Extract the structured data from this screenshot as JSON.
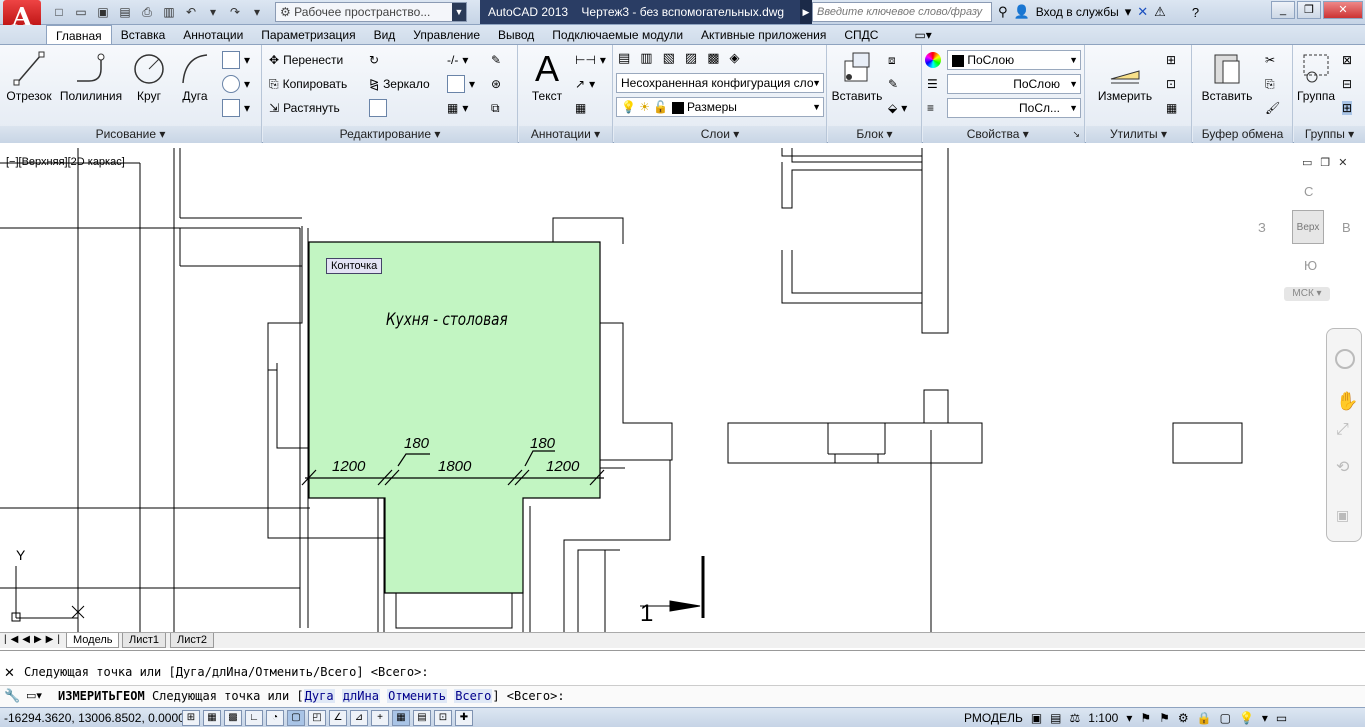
{
  "title_bar": {
    "app_letter": "A",
    "workspace": "Рабочее пространство...",
    "app_name": "AutoCAD 2013",
    "document": "Чертеж3 - без вспомогательных.dwg",
    "search_placeholder": "Введите ключевое слово/фразу",
    "login": "Вход в службы"
  },
  "ribbon_tabs": [
    "Главная",
    "Вставка",
    "Аннотации",
    "Параметризация",
    "Вид",
    "Управление",
    "Вывод",
    "Подключаемые модули",
    "Активные приложения",
    "СПДС"
  ],
  "panels": {
    "draw": {
      "title": "Рисование",
      "line": "Отрезок",
      "polyline": "Полилиния",
      "circle": "Круг",
      "arc": "Дуга"
    },
    "modify": {
      "title": "Редактирование",
      "move": "Перенести",
      "copy": "Копировать",
      "stretch": "Растянуть",
      "mirror": "Зеркало"
    },
    "annotation": {
      "title": "Аннотации",
      "text": "Текст"
    },
    "layers": {
      "title": "Слои",
      "layer_state": "Несохраненная конфигурация сло",
      "current_layer": "Размеры"
    },
    "block": {
      "title": "Блок",
      "insert": "Вставить"
    },
    "properties": {
      "title": "Свойства",
      "color": "ПоСлою",
      "linetype": "ПоСлою",
      "lineweight": "ПоСл..."
    },
    "utilities": {
      "title": "Утилиты",
      "measure": "Измерить"
    },
    "clipboard": {
      "title": "Буфер обмена",
      "paste": "Вставить"
    },
    "groups": {
      "title": "Группы",
      "group": "Группа"
    }
  },
  "viewport": {
    "label": "[−][Верхняя][2D каркас]",
    "tooltip": "Конточка",
    "room_name": "Кухня - столовая",
    "dims": [
      "1200",
      "180",
      "1800",
      "180",
      "1200"
    ],
    "section_mark": "1",
    "viewcube": {
      "north": "С",
      "south": "Ю",
      "west": "З",
      "east": "В",
      "face": "Верх",
      "ucs": "МСК"
    },
    "axis_y": "Y",
    "axis_x": "X"
  },
  "layout_tabs": [
    "Модель",
    "Лист1",
    "Лист2"
  ],
  "command": {
    "history": "Следующая точка или [Дуга/длИна/Отменить/Всего] <Всего>:",
    "cmd_name": "ИЗМЕРИТЬГЕОМ",
    "prompt": "Следующая точка или [",
    "options": [
      "Дуга",
      "длИна",
      "Отменить",
      "Всего"
    ],
    "default": "] <Всего>:"
  },
  "status_bar": {
    "coords": "-16294.3620, 13006.8502, 0.0000",
    "space": "РМОДЕЛЬ",
    "scale": "1:100"
  },
  "colors": {
    "fill_room": "#c2f5c2",
    "title_doc": "#2a3d64",
    "app_button": "#c11"
  }
}
